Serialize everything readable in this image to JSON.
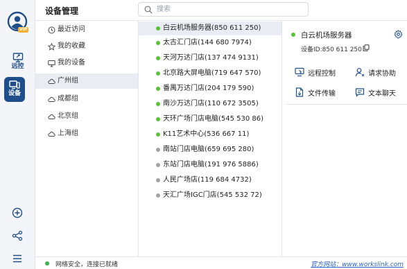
{
  "app": {
    "title": "设备管理",
    "vip_badge": "VIP"
  },
  "rail": {
    "items": [
      {
        "label": "远控",
        "icon": "monitor-remote-icon"
      },
      {
        "label": "设备",
        "icon": "device-icon",
        "active": true
      }
    ],
    "bottom_icons": [
      "add-circle-icon",
      "share-icon",
      "menu-icon"
    ]
  },
  "search": {
    "placeholder": "搜索",
    "value": ""
  },
  "nav": {
    "items": [
      {
        "label": "最近访问",
        "icon": "clock-icon"
      },
      {
        "label": "我的收藏",
        "icon": "star-icon"
      },
      {
        "label": "我的设备",
        "icon": "monitor-icon"
      },
      {
        "label": "广州组",
        "icon": "cloud-icon",
        "active": true
      },
      {
        "label": "成都组",
        "icon": "cloud-icon"
      },
      {
        "label": "北京组",
        "icon": "cloud-icon"
      },
      {
        "label": "上海组",
        "icon": "cloud-icon"
      }
    ]
  },
  "devices": [
    {
      "label": "白云机场服务器(850 611 250)",
      "online": true,
      "selected": true
    },
    {
      "label": "太古汇门店(144 680 7974)",
      "online": true
    },
    {
      "label": "天河万达门店(137 474 9131)",
      "online": true
    },
    {
      "label": "北京路大屏电脑(719 647 570)",
      "online": true
    },
    {
      "label": "番禺万达门店(204 179 590)",
      "online": true
    },
    {
      "label": "南沙万达门店(110 672 3505)",
      "online": true
    },
    {
      "label": "天环广场门店电脑(545 530 86)",
      "online": true
    },
    {
      "label": "K11艺术中心(536 667 11)",
      "online": true
    },
    {
      "label": "南站门店电脑(659 695 280)",
      "online": false
    },
    {
      "label": "东站门店电脑(191 976 5886)",
      "online": false
    },
    {
      "label": "人民广场店(119 684 4732)",
      "online": false
    },
    {
      "label": "天汇广场IGC门店(545 532 72)",
      "online": false
    }
  ],
  "detail": {
    "name": "白云机场服务器",
    "device_id": "设备ID:850 611 250",
    "actions": {
      "remote_control": "远程控制",
      "request_assist": "请求协助",
      "file_transfer": "文件传输",
      "text_chat": "文本聊天"
    }
  },
  "status": {
    "text": "网络安全，连接已就绪",
    "link": "官方网站：www.workslink.com"
  },
  "colors": {
    "accent": "#1f4f8a",
    "online": "#5bc236",
    "offline": "#a3a3a3",
    "link": "#2a63c4"
  }
}
